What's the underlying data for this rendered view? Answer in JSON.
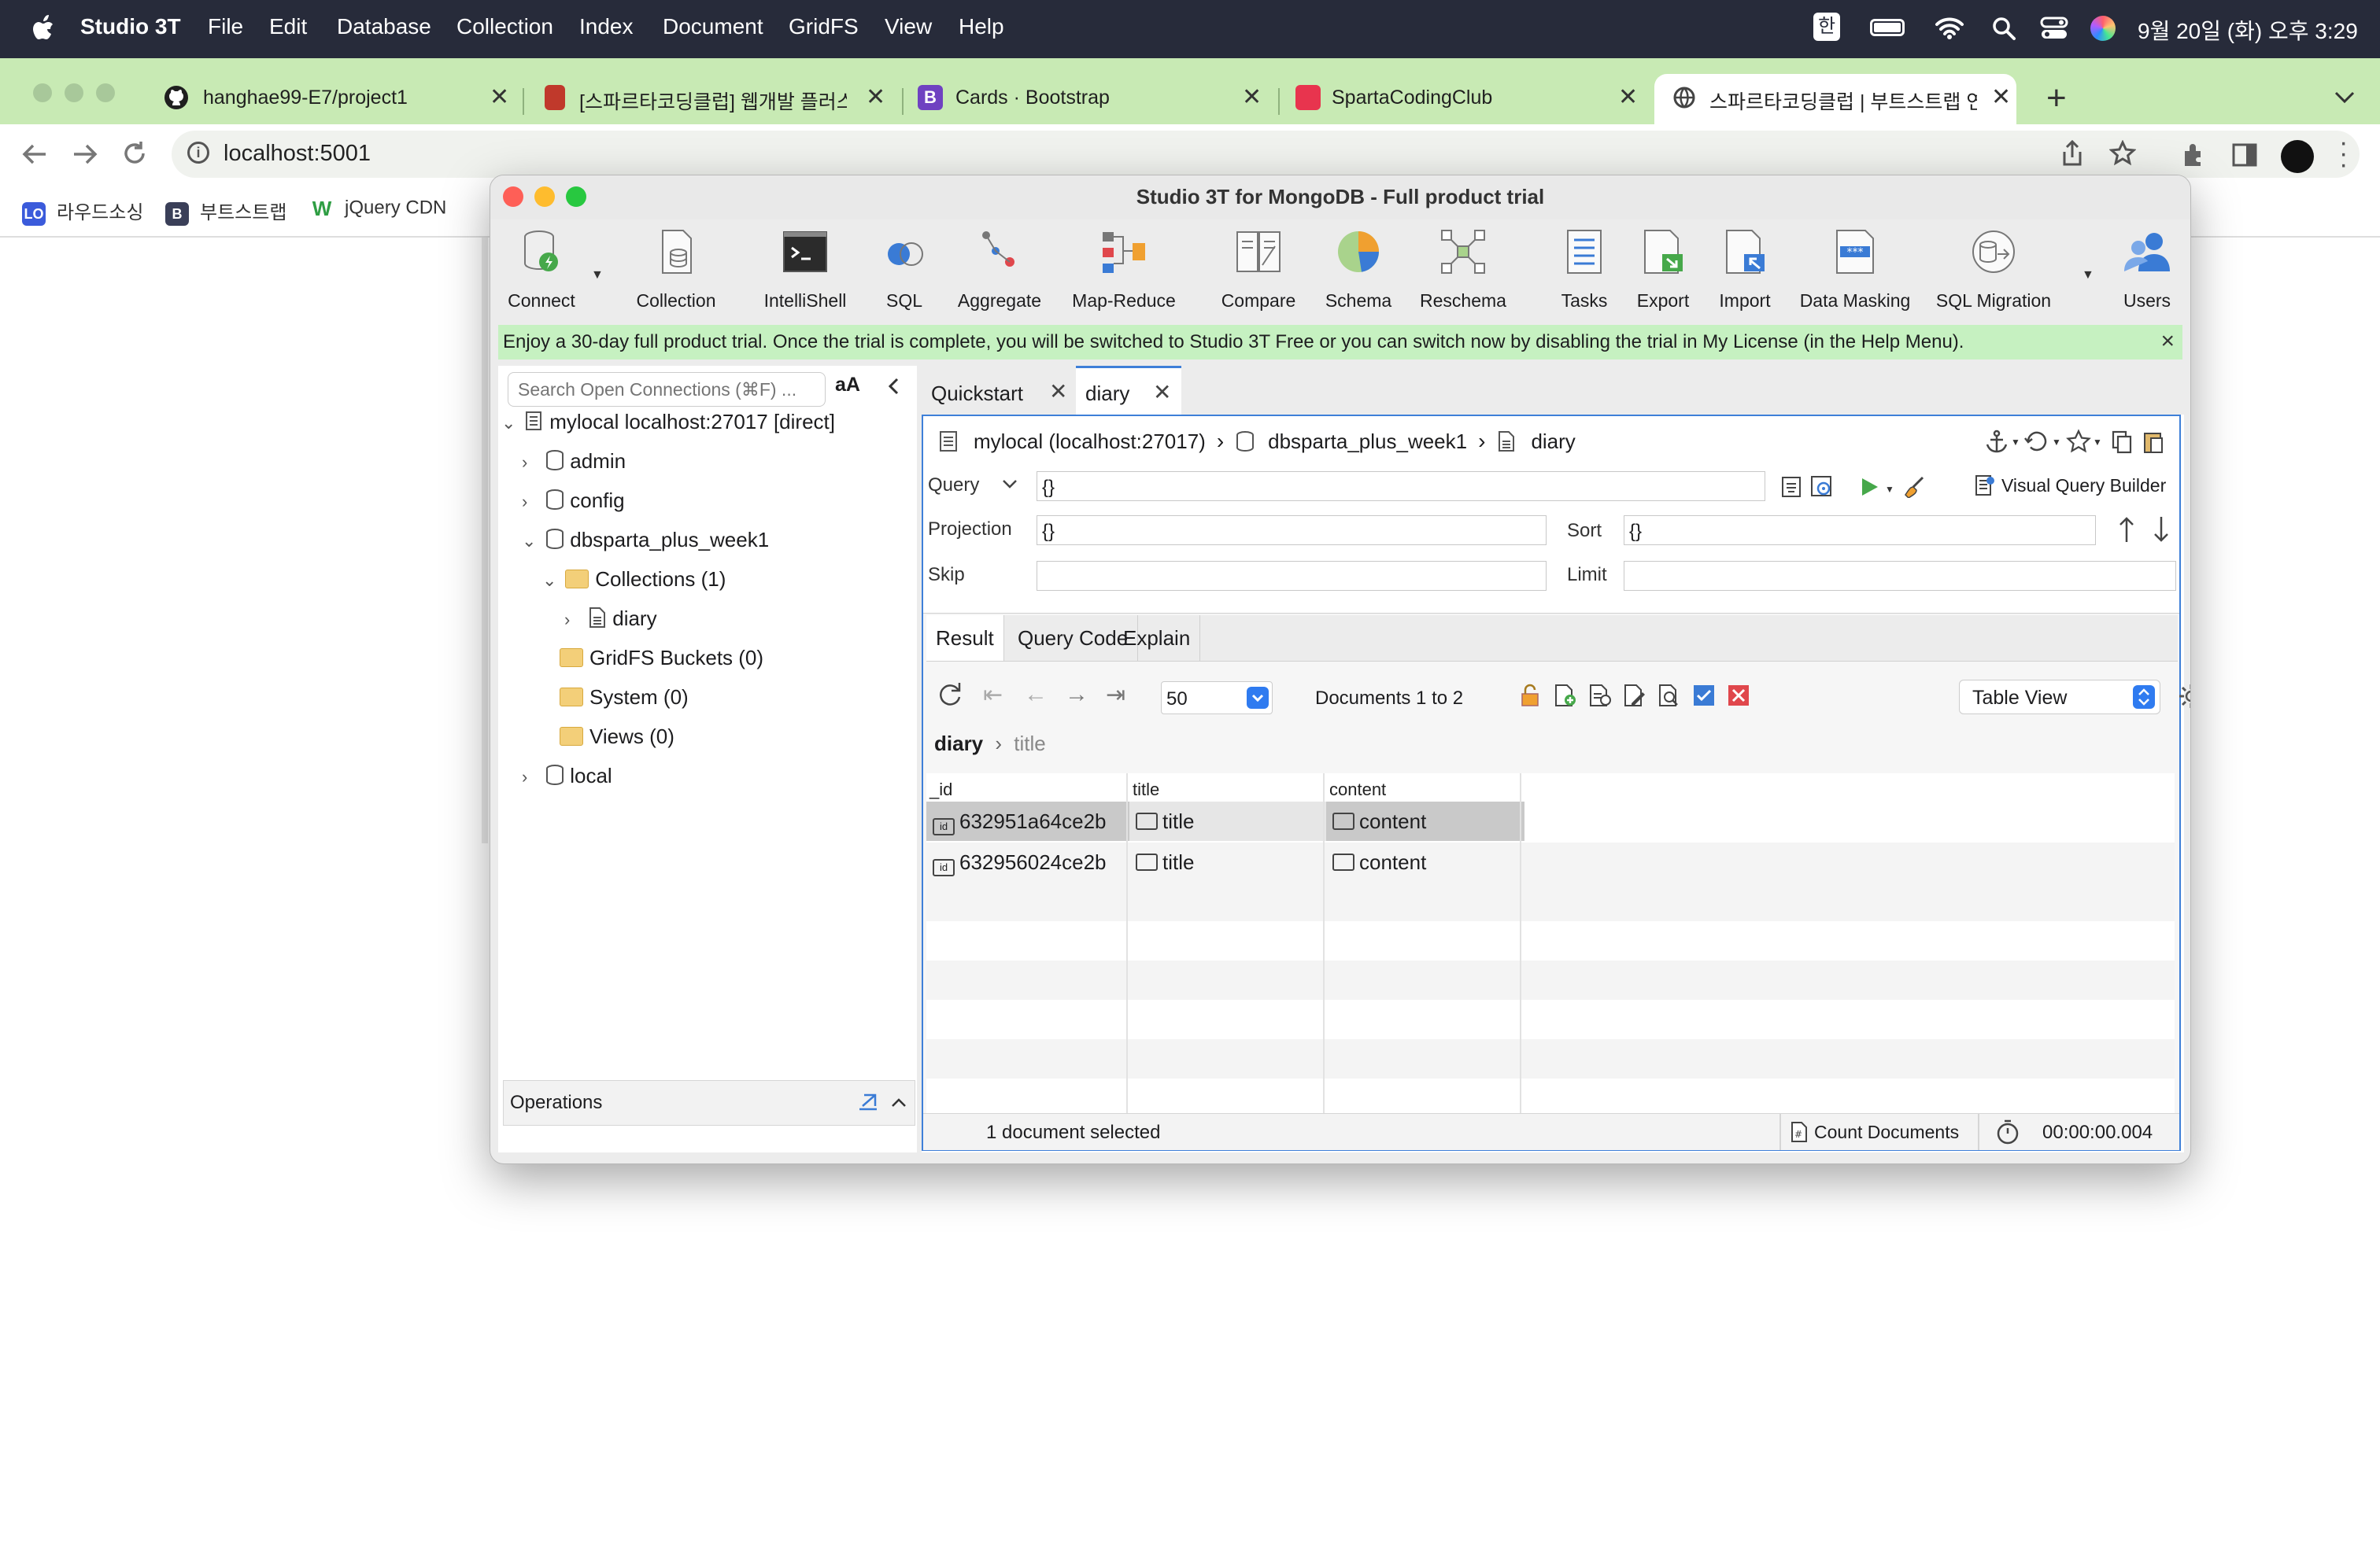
{
  "menubar": {
    "app_name": "Studio 3T",
    "items": [
      "File",
      "Edit",
      "Database",
      "Collection",
      "Index",
      "Document",
      "GridFS",
      "View",
      "Help"
    ],
    "ime": "한",
    "datetime": "9월 20일 (화) 오후 3:29"
  },
  "browser": {
    "tabs": [
      {
        "label": "hanghae99-E7/project1",
        "favicon": "github-icon"
      },
      {
        "label": "[스파르타코딩클럽] 웹개발 플러스 -",
        "favicon": "book-icon"
      },
      {
        "label": "Cards · Bootstrap",
        "favicon": "bootstrap-icon"
      },
      {
        "label": "SpartaCodingClub",
        "favicon": "sparta-icon"
      },
      {
        "label": "스파르타코딩클럽 | 부트스트랩 연습",
        "favicon": "globe-icon"
      }
    ],
    "url": "localhost:5001",
    "bookmarks": [
      {
        "label": "라우드소싱",
        "badge": "LO"
      },
      {
        "label": "부트스트랩",
        "badge": "B"
      },
      {
        "label": "jQuery CDN",
        "badge": "W"
      }
    ]
  },
  "studio": {
    "title": "Studio 3T for MongoDB - Full product trial",
    "ribbon": [
      "Connect",
      "Collection",
      "IntelliShell",
      "SQL",
      "Aggregate",
      "Map-Reduce",
      "Compare",
      "Schema",
      "Reschema",
      "Tasks",
      "Export",
      "Import",
      "Data Masking",
      "SQL Migration",
      "Users"
    ],
    "banner": "Enjoy a 30-day full product trial. Once the trial is complete, you will be switched to Studio 3T Free or you can switch now by disabling the trial in My License (in the Help Menu).",
    "search_placeholder": "Search Open Connections (⌘F) ...",
    "font_toggle": "aA",
    "tree": {
      "connection": "mylocal localhost:27017 [direct]",
      "dbs": [
        "admin",
        "config",
        "dbsparta_plus_week1"
      ],
      "collections_folder": "Collections (1)",
      "collection": "diary",
      "gridfs": "GridFS Buckets (0)",
      "system": "System (0)",
      "views": "Views (0)",
      "local": "local"
    },
    "operations": "Operations",
    "doc_tabs": [
      "Quickstart",
      "diary"
    ],
    "breadcrumb": {
      "conn": "mylocal (localhost:27017)",
      "db": "dbsparta_plus_week1",
      "coll": "diary"
    },
    "query": {
      "query_label": "Query",
      "query_value": "{}",
      "visual_builder": "Visual Query Builder",
      "projection_label": "Projection",
      "projection_value": "{}",
      "sort_label": "Sort",
      "sort_value": "{}",
      "skip_label": "Skip",
      "limit_label": "Limit"
    },
    "result_tabs": [
      "Result",
      "Query Code",
      "Explain"
    ],
    "page_size": "50",
    "docs_range": "Documents 1 to 2",
    "view_mode": "Table View",
    "path": {
      "root": "diary",
      "field": "title"
    },
    "columns": [
      "_id",
      "title",
      "content"
    ],
    "rows": [
      {
        "id": "632951a64ce2b",
        "title": "title",
        "content": "content"
      },
      {
        "id": "632956024ce2b",
        "title": "title",
        "content": "content"
      }
    ],
    "status": {
      "selected": "1 document selected",
      "count_button": "Count Documents",
      "elapsed": "00:00:00.004"
    }
  }
}
